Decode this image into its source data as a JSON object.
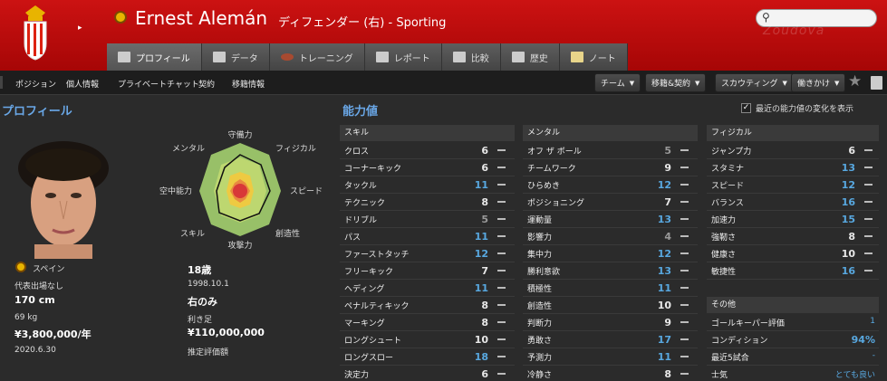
{
  "header": {
    "name": "Ernest Alemán",
    "role": "ディフェンダー (右) - Sporting",
    "search_placeholder": "",
    "watermark": "Zoudova"
  },
  "tabs": [
    {
      "label": "プロフィール",
      "active": true
    },
    {
      "label": "データ"
    },
    {
      "label": "トレーニング"
    },
    {
      "label": "レポート"
    },
    {
      "label": "比較"
    },
    {
      "label": "歴史"
    },
    {
      "label": "ノート"
    }
  ],
  "subnav": {
    "links": [
      "ポジション",
      "個人情報",
      "プライベートチャット",
      "契約",
      "移籍情報"
    ],
    "dropdowns": [
      "チーム",
      "移籍&契約",
      "スカウティング",
      "働きかけ"
    ]
  },
  "profile": {
    "title": "プロフィール",
    "nationality": "スペイン",
    "caps": "代表出場なし",
    "height": "170 cm",
    "weight": "69 kg",
    "wage": "¥3,800,000/年",
    "contract_end": "2020.6.30",
    "age": "18歳",
    "dob": "1998.10.1",
    "foot": "右のみ",
    "foot_label": "利き足",
    "value": "¥110,000,000",
    "value_label": "推定評価額"
  },
  "radar": {
    "labels": [
      "守備力",
      "フィジカル",
      "スピード",
      "創造性",
      "攻撃力",
      "スキル",
      "空中能力",
      "メンタル"
    ]
  },
  "ability": {
    "title": "能力値",
    "show_change": "最近の能力値の変化を表示",
    "skills_head": "スキル",
    "mental_head": "メンタル",
    "physical_head": "フィジカル",
    "skills": [
      {
        "label": "クロス",
        "value": "6"
      },
      {
        "label": "コーナーキック",
        "value": "6"
      },
      {
        "label": "タックル",
        "value": "11"
      },
      {
        "label": "テクニック",
        "value": "8"
      },
      {
        "label": "ドリブル",
        "value": "5"
      },
      {
        "label": "パス",
        "value": "11"
      },
      {
        "label": "ファーストタッチ",
        "value": "12"
      },
      {
        "label": "フリーキック",
        "value": "7"
      },
      {
        "label": "ヘディング",
        "value": "11"
      },
      {
        "label": "ペナルティキック",
        "value": "8"
      },
      {
        "label": "マーキング",
        "value": "8"
      },
      {
        "label": "ロングシュート",
        "value": "10"
      },
      {
        "label": "ロングスロー",
        "value": "18"
      },
      {
        "label": "決定力",
        "value": "6"
      }
    ],
    "mental": [
      {
        "label": "オフ ザ ボール",
        "value": "5"
      },
      {
        "label": "チームワーク",
        "value": "9"
      },
      {
        "label": "ひらめき",
        "value": "12"
      },
      {
        "label": "ポジショニング",
        "value": "7"
      },
      {
        "label": "運動量",
        "value": "13"
      },
      {
        "label": "影響力",
        "value": "4"
      },
      {
        "label": "集中力",
        "value": "12"
      },
      {
        "label": "勝利意欲",
        "value": "13"
      },
      {
        "label": "積極性",
        "value": "11"
      },
      {
        "label": "創造性",
        "value": "10"
      },
      {
        "label": "判断力",
        "value": "9"
      },
      {
        "label": "勇敢さ",
        "value": "17"
      },
      {
        "label": "予測力",
        "value": "11"
      },
      {
        "label": "冷静さ",
        "value": "8"
      }
    ],
    "physical": [
      {
        "label": "ジャンプ力",
        "value": "6"
      },
      {
        "label": "スタミナ",
        "value": "13"
      },
      {
        "label": "スピード",
        "value": "12"
      },
      {
        "label": "バランス",
        "value": "16"
      },
      {
        "label": "加速力",
        "value": "15"
      },
      {
        "label": "強靭さ",
        "value": "8"
      },
      {
        "label": "健康さ",
        "value": "10"
      },
      {
        "label": "敏捷性",
        "value": "16"
      }
    ],
    "other_head": "その他",
    "other": [
      {
        "label": "ゴールキーパー評価",
        "value": "1"
      },
      {
        "label": "コンディション",
        "value": "94%"
      },
      {
        "label": "最近5試合",
        "value": "-"
      },
      {
        "label": "士気",
        "value": "とても良い"
      }
    ]
  },
  "colors": {
    "header_red": "#b80a0a",
    "accent_blue": "#58a8e0"
  }
}
